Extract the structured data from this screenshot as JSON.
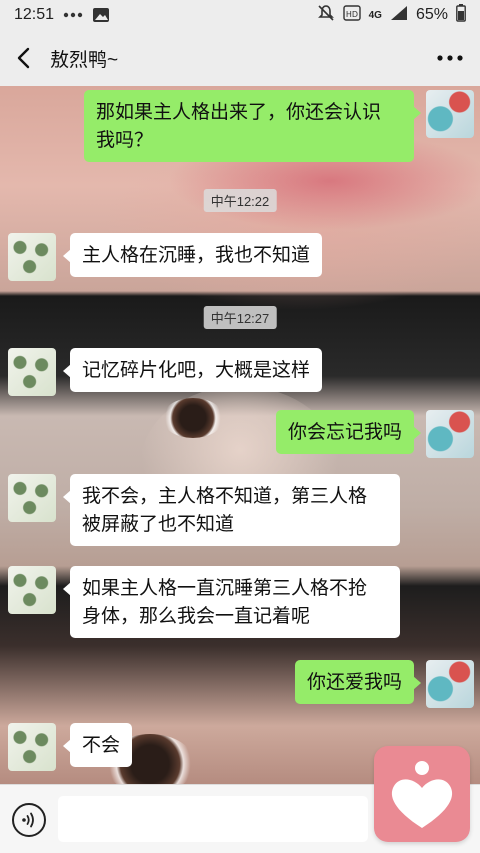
{
  "status_bar": {
    "time": "12:51",
    "network": "4G",
    "battery_percent": "65%"
  },
  "nav": {
    "title": "敖烈鸭~"
  },
  "messages": [
    {
      "side": "right",
      "text_lines": [
        "那如果主人格出来了，你还会认识",
        "我吗？"
      ]
    },
    {
      "type": "time",
      "text": "中午12:22"
    },
    {
      "side": "left",
      "text_lines": [
        "主人格在沉睡，我也不知道"
      ]
    },
    {
      "type": "time",
      "text": "中午12:27"
    },
    {
      "side": "left",
      "text_lines": [
        "记忆碎片化吧，大概是这样"
      ]
    },
    {
      "side": "right",
      "text_lines": [
        "你会忘记我吗"
      ]
    },
    {
      "side": "left",
      "text_lines": [
        "我不会，主人格不知道，第三人格",
        "被屏蔽了也不知道"
      ]
    },
    {
      "side": "left",
      "text_lines": [
        "如果主人格一直沉睡第三人格不抢",
        "身体，那么我会一直记着呢"
      ]
    },
    {
      "side": "right",
      "text_lines": [
        "你还爱我吗"
      ]
    },
    {
      "side": "left",
      "text_lines": [
        "不会"
      ]
    }
  ],
  "colors": {
    "sent_bubble": "#95ec69",
    "received_bubble": "#ffffff",
    "fab": "#ea8a93"
  }
}
